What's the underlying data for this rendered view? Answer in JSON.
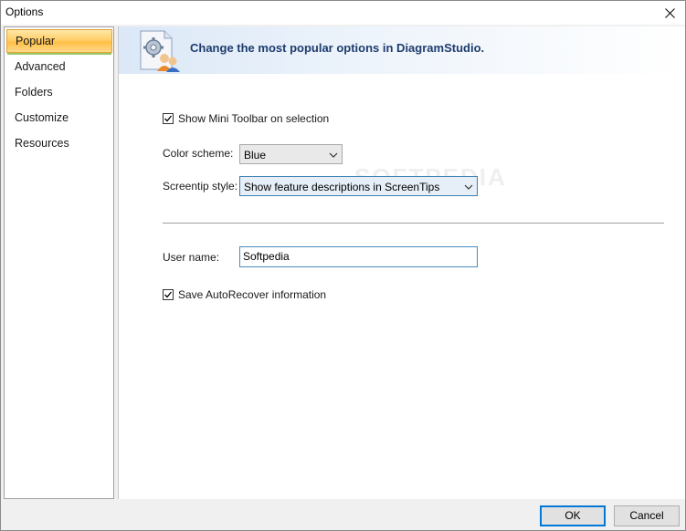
{
  "window": {
    "title": "Options"
  },
  "sidebar": {
    "items": [
      {
        "label": "Popular",
        "selected": true
      },
      {
        "label": "Advanced",
        "selected": false
      },
      {
        "label": "Folders",
        "selected": false
      },
      {
        "label": "Customize",
        "selected": false
      },
      {
        "label": "Resources",
        "selected": false
      }
    ]
  },
  "header": {
    "title": "Change the most popular options in DiagramStudio.",
    "icon": "settings-users-icon"
  },
  "options": {
    "mini_toolbar": {
      "label": "Show Mini Toolbar on selection",
      "checked": true
    },
    "color_scheme": {
      "label": "Color scheme:",
      "value": "Blue"
    },
    "screentip": {
      "label": "Screentip style:",
      "value": "Show feature descriptions in ScreenTips"
    },
    "user_name": {
      "label": "User name:",
      "value": "Softpedia"
    },
    "autorecover": {
      "label": "Save AutoRecover information",
      "checked": true
    }
  },
  "footer": {
    "ok_label": "OK",
    "cancel_label": "Cancel"
  },
  "watermark": "SOFTPEDIA",
  "colors": {
    "accent": "#0078d7",
    "selected_nav": "#ffcf6b",
    "header_title": "#1e3c6e"
  }
}
